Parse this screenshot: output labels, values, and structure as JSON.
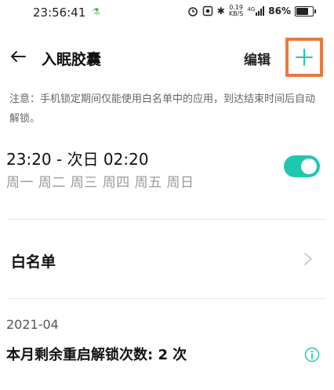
{
  "status_bar": {
    "time": "23:56:41",
    "network_speed_value": "0.19",
    "network_speed_unit": "KB/S",
    "signal_text": "4G",
    "battery_percent": "86%",
    "battery_level": 0.86
  },
  "nav": {
    "title": "入眠胶囊",
    "edit_label": "编辑"
  },
  "notice": "注意：手机锁定期间仅能使用白名单中的应用，到达结束时间后自动解锁。",
  "schedule": {
    "time_range": "23:20 - 次日 02:20",
    "days": "周一 周二 周三 周四 周五 周日",
    "enabled": true
  },
  "whitelist": {
    "label": "白名单"
  },
  "restart": {
    "month": "2021-04",
    "text": "本月剩余重启解锁次数: 2 次"
  },
  "colors": {
    "accent": "#1fc7b0",
    "highlight_border": "#e8793f"
  }
}
